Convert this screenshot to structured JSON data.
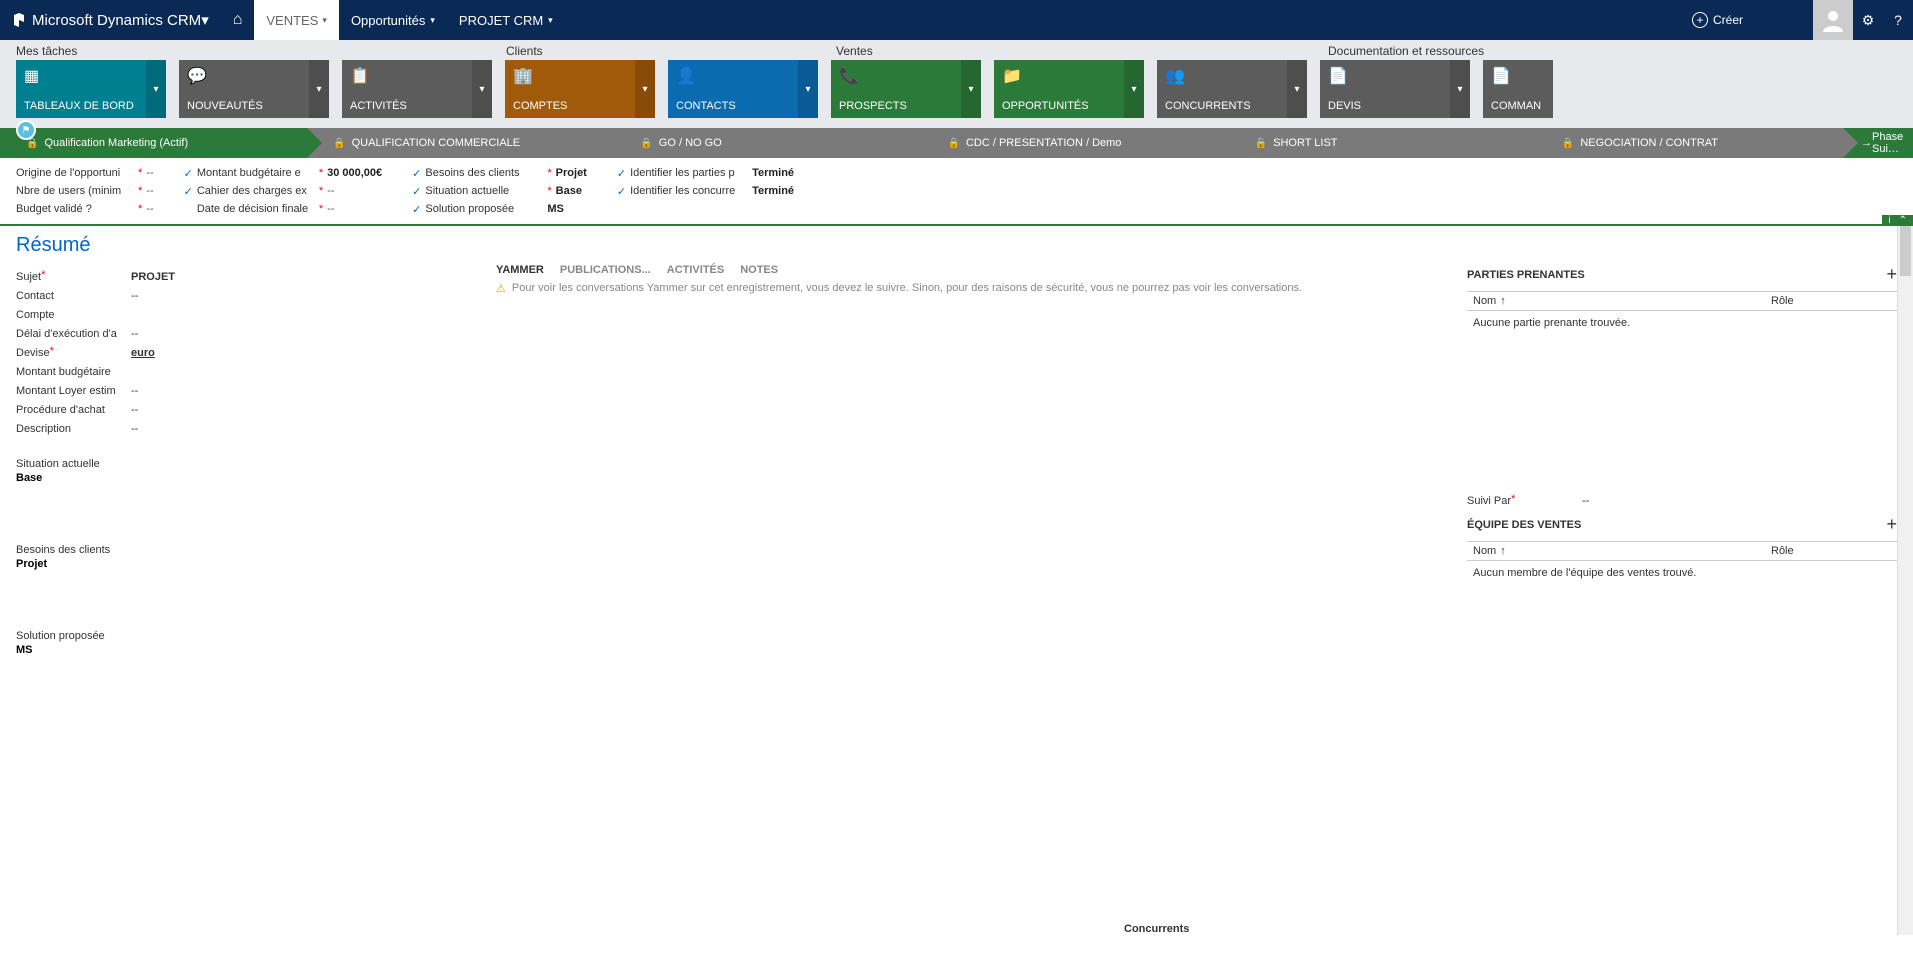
{
  "topnav": {
    "logo": "Microsoft Dynamics CRM",
    "home": "⌂",
    "items": [
      {
        "label": "VENTES",
        "active": true
      },
      {
        "label": "Opportunités",
        "active": false
      },
      {
        "label": "PROJET CRM",
        "active": false
      }
    ],
    "create": "Créer"
  },
  "categories": {
    "cat1": "Mes tâches",
    "cat2": "Clients",
    "cat3": "Ventes",
    "cat4": "Documentation et ressources"
  },
  "tiles": [
    {
      "label": "TABLEAUX DE BORD",
      "color": "teal"
    },
    {
      "label": "NOUVEAUTÉS",
      "color": "gray"
    },
    {
      "label": "ACTIVITÉS",
      "color": "gray"
    },
    {
      "label": "COMPTES",
      "color": "brown"
    },
    {
      "label": "CONTACTS",
      "color": "blue"
    },
    {
      "label": "PROSPECTS",
      "color": "green"
    },
    {
      "label": "OPPORTUNITÉS",
      "color": "green"
    },
    {
      "label": "CONCURRENTS",
      "color": "gray"
    },
    {
      "label": "DEVIS",
      "color": "gray"
    },
    {
      "label": "COMMAN",
      "color": "gray",
      "cut": true
    }
  ],
  "stages": [
    {
      "label": "Qualification Marketing (Actif)",
      "active": true
    },
    {
      "label": "QUALIFICATION COMMERCIALE",
      "active": false
    },
    {
      "label": "GO / NO GO",
      "active": false
    },
    {
      "label": "CDC / PRESENTATION / Demo",
      "active": false
    },
    {
      "label": "SHORT LIST",
      "active": false
    },
    {
      "label": "NEGOCIATION / CONTRAT",
      "active": false
    }
  ],
  "next_stage": "Phase Sui…",
  "stage_details": {
    "col1": [
      {
        "label": "Origine de l'opportuni",
        "req": true,
        "value": "--"
      },
      {
        "label": "Nbre de users (minim",
        "req": true,
        "value": "--"
      },
      {
        "label": "Budget validé ?",
        "req": true,
        "value": "--"
      }
    ],
    "col2": [
      {
        "check": true,
        "label": "Montant budgétaire e",
        "req": true,
        "value": "30 000,00€"
      },
      {
        "check": true,
        "label": "Cahier des charges ex",
        "req": true,
        "value": "--"
      },
      {
        "check": false,
        "label": "Date de décision finale",
        "req": true,
        "value": "--"
      }
    ],
    "col3": [
      {
        "check": true,
        "label": "Besoins des clients",
        "req": true,
        "value": "Projet"
      },
      {
        "check": true,
        "label": "Situation actuelle",
        "req": true,
        "value": "Base"
      },
      {
        "check": true,
        "label": "Solution proposée",
        "req": false,
        "value": "MS"
      }
    ],
    "col4": [
      {
        "check": true,
        "label": "Identifier les parties p",
        "value": "Terminé"
      },
      {
        "check": true,
        "label": "Identifier les concurre",
        "value": "Terminé"
      }
    ]
  },
  "resume_title": "Résumé",
  "fields": [
    {
      "label": "Sujet",
      "req": true,
      "value": "PROJET",
      "bold": true
    },
    {
      "label": "Contact",
      "value": "--"
    },
    {
      "label": "Compte",
      "value": ""
    },
    {
      "label": "Délai d'exécution d'a",
      "value": "--"
    },
    {
      "label": "Devise",
      "req": true,
      "value": "euro",
      "link": true
    },
    {
      "label": "Montant budgétaire",
      "value": ""
    },
    {
      "label": "Montant Loyer estim",
      "value": "--"
    },
    {
      "label": "Procédure d'achat",
      "value": "--"
    },
    {
      "label": "Description",
      "value": "--"
    }
  ],
  "text_sections": [
    {
      "label": "Situation actuelle",
      "value": "Base"
    },
    {
      "label": "Besoins des clients",
      "value": "Projet"
    },
    {
      "label": "Solution proposée",
      "value": "MS"
    }
  ],
  "mid_tabs": [
    "YAMMER",
    "PUBLICATIONS...",
    "ACTIVITÉS",
    "NOTES"
  ],
  "yammer_msg": "Pour voir les conversations Yammer sur cet enregistrement, vous devez le suivre. Sinon, pour des raisons de sécurité, vous ne pourrez pas voir les conversations.",
  "panels": {
    "parties": {
      "title": "PARTIES PRENANTES",
      "col1": "Nom",
      "col2": "Rôle",
      "empty": "Aucune partie prenante trouvée."
    },
    "suivi": {
      "label": "Suivi Par",
      "req": true,
      "value": "--"
    },
    "equipe": {
      "title": "ÉQUIPE DES VENTES",
      "col1": "Nom",
      "col2": "Rôle",
      "empty": "Aucun membre de l'équipe des ventes trouvé."
    },
    "concurrents": "Concurrents"
  }
}
